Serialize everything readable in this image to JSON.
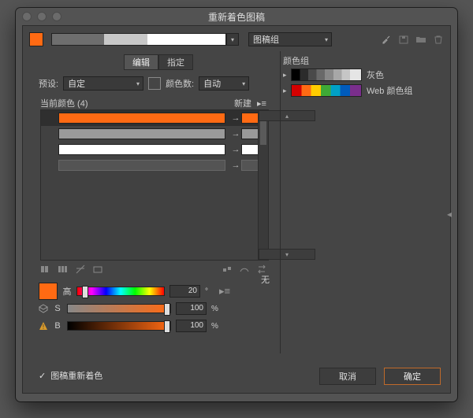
{
  "window": {
    "title": "重新着色图稿"
  },
  "top": {
    "color_group_select": "图稿组"
  },
  "tabs": [
    "编辑",
    "指定"
  ],
  "preset": {
    "label": "预设:",
    "value": "自定",
    "count_label": "颜色数:",
    "count_value": "自动"
  },
  "list": {
    "header": "当前颜色 (4)",
    "new_label": "新建",
    "rows": [
      {
        "idx": "",
        "src": "#ff6a13",
        "dst": "#ff6a13"
      },
      {
        "idx": "",
        "src": "#9a9a9a",
        "dst": "#9a9a9a"
      },
      {
        "idx": "",
        "src": "#ffffff",
        "dst": "#ffffff"
      },
      {
        "idx": "",
        "src": "#545454",
        "dst": "#545454"
      }
    ]
  },
  "hsb": {
    "h_label": "高",
    "s_label": "S",
    "b_label": "B",
    "h": "20",
    "s": "100",
    "b": "100",
    "pct": "%"
  },
  "misc": {
    "none": "无"
  },
  "groups": {
    "title": "颜色组",
    "items": [
      {
        "label": "灰色"
      },
      {
        "label": "Web 颜色组"
      }
    ]
  },
  "footer": {
    "recolor_label": "图稿重新着色",
    "cancel": "取消",
    "ok": "确定"
  },
  "colors": {
    "accent": "#ff6a13",
    "panel": "#454545",
    "window": "#535353"
  }
}
